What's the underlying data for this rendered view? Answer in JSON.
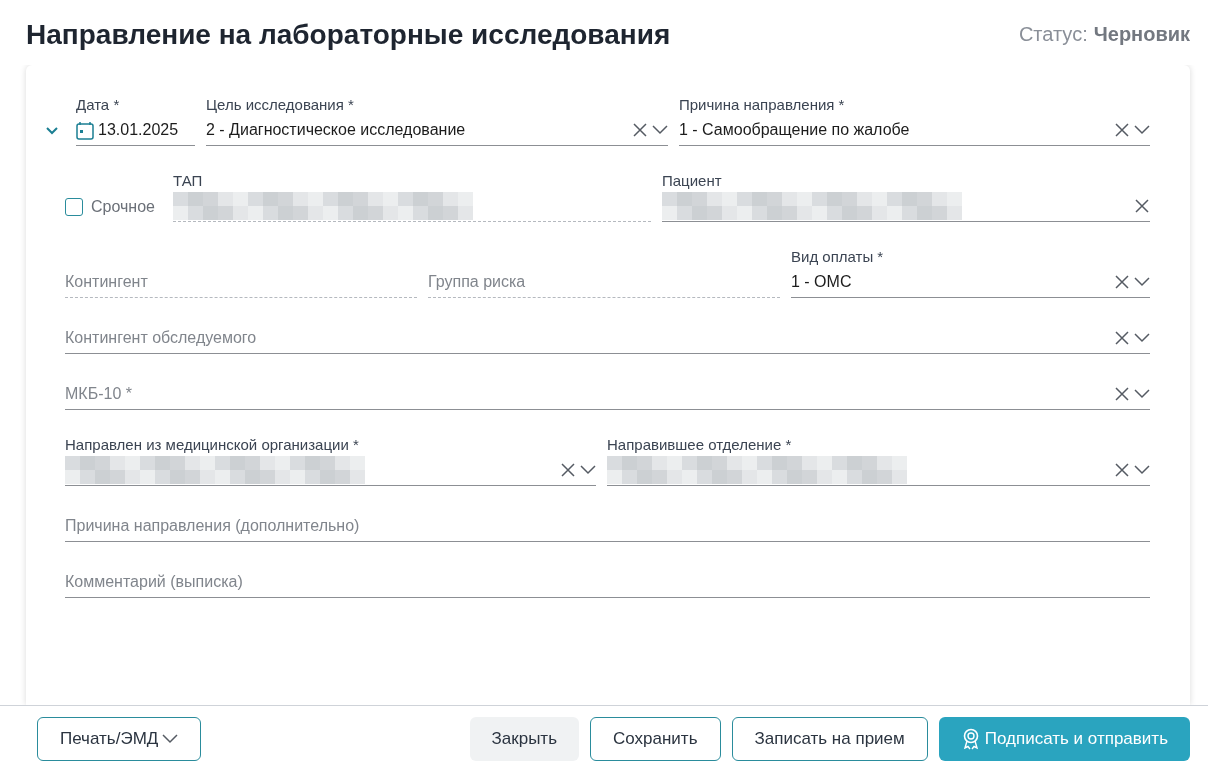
{
  "title": "Направление на лабораторные исследования",
  "status": {
    "label": "Статус:",
    "value": "Черновик"
  },
  "section": {
    "expanded": true
  },
  "rows": [
    {
      "fields": [
        {
          "kind": "date",
          "label": "Дата *",
          "value": "13.01.2025"
        },
        {
          "kind": "select",
          "label": "Цель исследования *",
          "value": "2 - Диагностическое исследование",
          "clear": true,
          "dropdown": true
        },
        {
          "kind": "select",
          "label": "Причина направления *",
          "value": "1 - Самообращение по жалобе",
          "clear": true,
          "dropdown": true
        }
      ]
    },
    {
      "fields": [
        {
          "kind": "checkbox",
          "label": "Срочное",
          "checked": false
        },
        {
          "kind": "text",
          "label": "ТАП",
          "value_hidden": true,
          "readonly": true
        },
        {
          "kind": "select",
          "label": "Пациент",
          "value_hidden": true,
          "clear": true
        }
      ]
    },
    {
      "fields": [
        {
          "kind": "text",
          "placeholder": "Контингент",
          "readonly": true
        },
        {
          "kind": "text",
          "placeholder": "Группа риска",
          "readonly": true
        },
        {
          "kind": "select",
          "label": "Вид оплаты *",
          "value": "1 - ОМС",
          "clear": true,
          "dropdown": true
        }
      ]
    },
    {
      "fields": [
        {
          "kind": "select",
          "placeholder": "Контингент обследуемого",
          "clear": true,
          "dropdown": true
        }
      ]
    },
    {
      "fields": [
        {
          "kind": "select",
          "placeholder": "МКБ-10 *",
          "clear": true,
          "dropdown": true
        }
      ]
    },
    {
      "fields": [
        {
          "kind": "select",
          "label": "Направлен из медицинской организации *",
          "value_hidden": true,
          "clear": true,
          "dropdown": true
        },
        {
          "kind": "select",
          "label": "Направившее отделение *",
          "value_hidden": true,
          "clear": true,
          "dropdown": true
        }
      ]
    },
    {
      "fields": [
        {
          "kind": "text",
          "placeholder": "Причина направления (дополнительно)"
        }
      ]
    },
    {
      "fields": [
        {
          "kind": "text",
          "placeholder": "Комментарий (выписка)"
        }
      ]
    }
  ],
  "footer": {
    "left": [
      {
        "kind": "outline",
        "label": "Печать/ЭМД",
        "dropdown": true
      }
    ],
    "right": [
      {
        "kind": "plain",
        "label": "Закрыть"
      },
      {
        "kind": "outline",
        "label": "Сохранить"
      },
      {
        "kind": "outline",
        "label": "Записать на прием"
      },
      {
        "kind": "primary",
        "label": "Подписать и отправить"
      }
    ]
  }
}
